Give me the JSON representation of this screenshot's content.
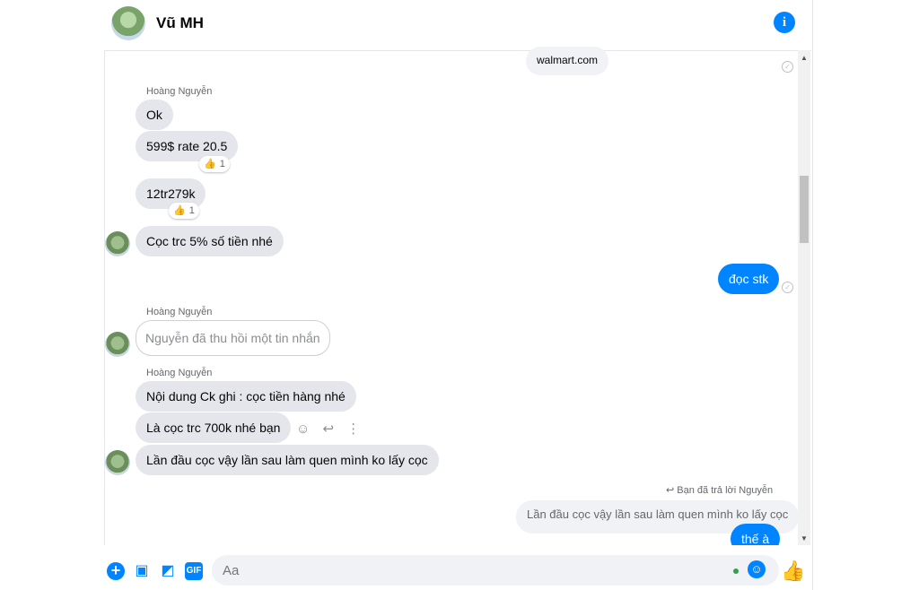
{
  "header": {
    "title": "Vũ MH",
    "info_icon": "info-icon"
  },
  "messages": {
    "top_link": "walmart.com",
    "sender1": "Hoàng Nguyễn",
    "m_ok": "Ok",
    "m_rate": "599$ rate 20.5",
    "m_rate_react": "1",
    "m_total": "12tr279k",
    "m_total_react": "1",
    "m_deposit": "Cọc trc 5% số tiền nhé",
    "m_doc_stk": "đọc stk",
    "sender2": "Hoàng Nguyễn",
    "m_recalled": "Nguyễn đã thu hồi một tin nhắn",
    "sender3": "Hoàng Nguyễn",
    "m_content": "Nội dung Ck ghi : cọc tiền hàng nhé",
    "m_700k": "Là cọc trc 700k nhé bạn",
    "m_first": "Lần đầu cọc vậy lần sau làm quen mình ko lấy cọc",
    "reply_note": "Bạn đã trả lời Nguyễn",
    "quoted": "Lần đầu cọc vậy lần sau làm quen mình ko lấy cọc",
    "m_the_a": "thế à"
  },
  "composer": {
    "placeholder": "Aa",
    "gif_label": "GIF",
    "plus": "+",
    "tools": [
      "plus-icon",
      "image-icon",
      "sticker-icon",
      "gif-icon"
    ],
    "emoji_icon": "smile-icon",
    "like_icon": "thumbs-up-icon"
  },
  "colors": {
    "accent": "#0084ff",
    "incoming": "#e4e6eb"
  }
}
